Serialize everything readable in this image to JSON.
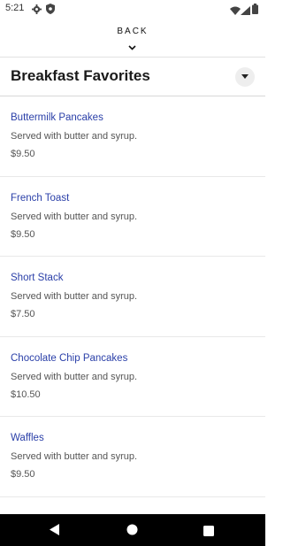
{
  "status_bar": {
    "time": "5:21",
    "icons": [
      "gear-icon",
      "shield-icon",
      "wifi-icon",
      "signal-icon",
      "battery-icon"
    ]
  },
  "nav": {
    "back_label": "BACK",
    "chevron_icon": "chevron-down-icon"
  },
  "category": {
    "title": "Breakfast Favorites",
    "toggle_icon": "caret-down-icon"
  },
  "items": [
    {
      "name": "Buttermilk Pancakes",
      "description": "Served with butter and syrup.",
      "price": "$9.50"
    },
    {
      "name": "French Toast",
      "description": "Served with butter and syrup.",
      "price": "$9.50"
    },
    {
      "name": "Short Stack",
      "description": "Served with butter and syrup.",
      "price": "$7.50"
    },
    {
      "name": "Chocolate Chip Pancakes",
      "description": "Served with butter and syrup.",
      "price": "$10.50"
    },
    {
      "name": "Waffles",
      "description": "Served with butter and syrup.",
      "price": "$9.50"
    }
  ],
  "system_nav": {
    "icons": [
      "back-triangle-icon",
      "home-circle-icon",
      "recents-square-icon"
    ]
  },
  "colors": {
    "item_name": "#2a3fa8",
    "text_muted": "#555555",
    "nav_bar": "#000000"
  }
}
